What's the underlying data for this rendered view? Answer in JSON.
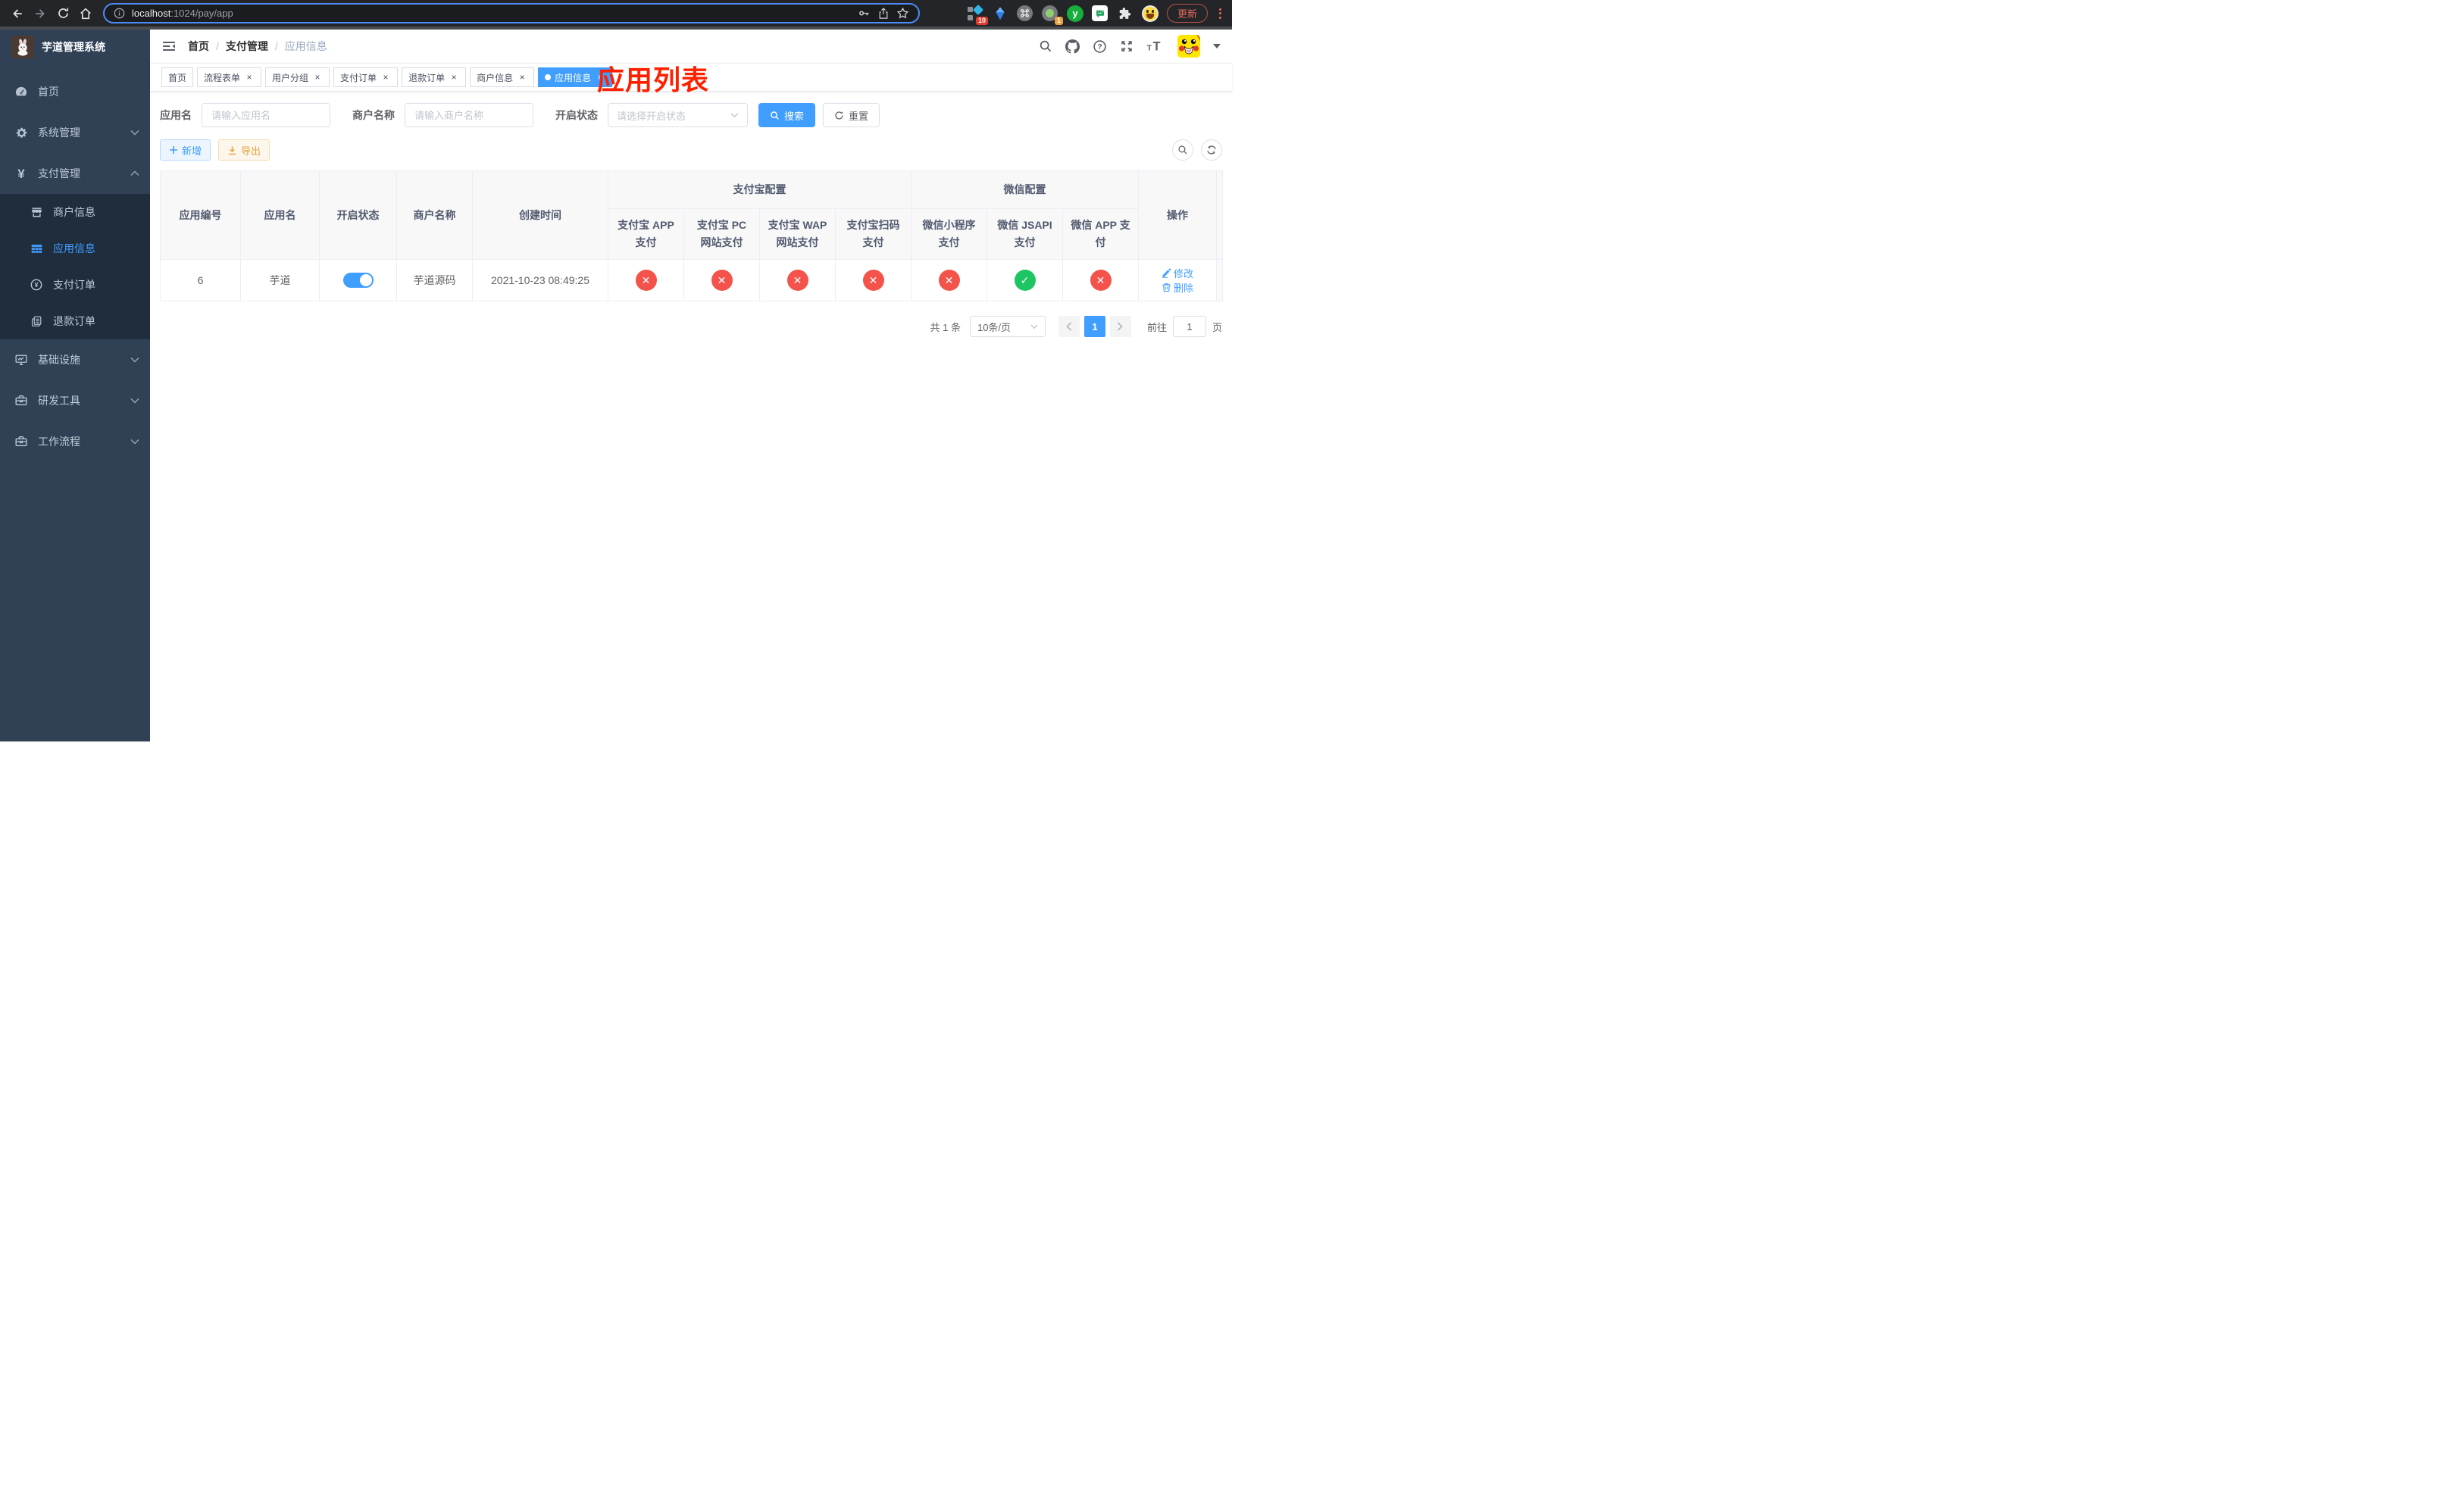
{
  "browser": {
    "url_host": "localhost",
    "url_path": ":1024/pay/app",
    "update_label": "更新",
    "extension_badges": {
      "diamond": "10",
      "circle": "1"
    },
    "y_extension_letter": "y"
  },
  "sidebar": {
    "title": "芋道管理系统",
    "items": [
      {
        "id": "home",
        "label": "首页",
        "icon": "dashboard-icon",
        "level": 1
      },
      {
        "id": "system-management",
        "label": "系统管理",
        "icon": "gear-icon",
        "level": 1,
        "chevron": "down"
      },
      {
        "id": "payment-management",
        "label": "支付管理",
        "icon": "yuan-icon",
        "level": 1,
        "chevron": "up"
      },
      {
        "id": "merchant-info",
        "label": "商户信息",
        "icon": "shop-icon",
        "level": 2
      },
      {
        "id": "app-info",
        "label": "应用信息",
        "icon": "grid-icon",
        "level": 2,
        "active": true
      },
      {
        "id": "payment-order",
        "label": "支付订单",
        "icon": "coin-icon",
        "level": 2
      },
      {
        "id": "refund-order",
        "label": "退款订单",
        "icon": "document-icon",
        "level": 2
      },
      {
        "id": "infrastructure",
        "label": "基础设施",
        "icon": "monitor-icon",
        "level": 1,
        "chevron": "down"
      },
      {
        "id": "dev-tools",
        "label": "研发工具",
        "icon": "toolbox-icon",
        "level": 1,
        "chevron": "down"
      },
      {
        "id": "workflow",
        "label": "工作流程",
        "icon": "briefcase-icon",
        "level": 1,
        "chevron": "down"
      }
    ]
  },
  "navbar": {
    "breadcrumb": [
      "首页",
      "支付管理",
      "应用信息"
    ]
  },
  "overlay_title": "应用列表",
  "tabs": [
    {
      "id": "tab-home",
      "label": "首页",
      "closable": false,
      "active": false
    },
    {
      "id": "tab-process-form",
      "label": "流程表单",
      "closable": true,
      "active": false
    },
    {
      "id": "tab-user-group",
      "label": "用户分组",
      "closable": true,
      "active": false
    },
    {
      "id": "tab-payment-order",
      "label": "支付订单",
      "closable": true,
      "active": false
    },
    {
      "id": "tab-refund-order",
      "label": "退款订单",
      "closable": true,
      "active": false
    },
    {
      "id": "tab-merchant-info",
      "label": "商户信息",
      "closable": true,
      "active": false
    },
    {
      "id": "tab-app-info",
      "label": "应用信息",
      "closable": true,
      "active": true
    }
  ],
  "filters": {
    "app_name_label": "应用名",
    "app_name_placeholder": "请输入应用名",
    "merchant_label": "商户名称",
    "merchant_placeholder": "请输入商户名称",
    "status_label": "开启状态",
    "status_placeholder": "请选择开启状态",
    "search_label": "搜索",
    "reset_label": "重置"
  },
  "toolbar": {
    "add_label": "新增",
    "export_label": "导出"
  },
  "table": {
    "group_headers": [
      {
        "label": "支付宝配置",
        "span": 4
      },
      {
        "label": "微信配置",
        "span": 3
      }
    ],
    "main_columns": [
      "应用编号",
      "应用名",
      "开启状态",
      "商户名称",
      "创建时间"
    ],
    "sub_columns": [
      {
        "id": "alipay-app",
        "label": "支付宝 APP 支付"
      },
      {
        "id": "alipay-pc",
        "label": "支付宝 PC 网站支付"
      },
      {
        "id": "alipay-wap",
        "label": "支付宝 WAP 网站支付"
      },
      {
        "id": "alipay-qr",
        "label": "支付宝扫码支付"
      },
      {
        "id": "wx-lite",
        "label": "微信小程序支付"
      },
      {
        "id": "wx-jsapi",
        "label": "微信 JSAPI 支付"
      },
      {
        "id": "wx-app",
        "label": "微信 APP 支付"
      }
    ],
    "op_column": "操作",
    "row": {
      "id": "6",
      "name": "芋道",
      "enabled": true,
      "merchant": "芋道源码",
      "created_at": "2021-10-23 08:49:25",
      "statuses": [
        false,
        false,
        false,
        false,
        false,
        true,
        false
      ],
      "edit_label": "修改",
      "delete_label": "删除"
    }
  },
  "pagination": {
    "total": "共 1 条",
    "page_size": "10条/页",
    "current_page": "1",
    "goto_label": "前往",
    "goto_value": "1",
    "page_unit": "页"
  },
  "colors": {
    "accent": "#409eff",
    "success": "#1ec563",
    "danger": "#f4534b",
    "warning": "#e6a23c",
    "title_red": "#ff2000",
    "sidebar": "#304156"
  }
}
